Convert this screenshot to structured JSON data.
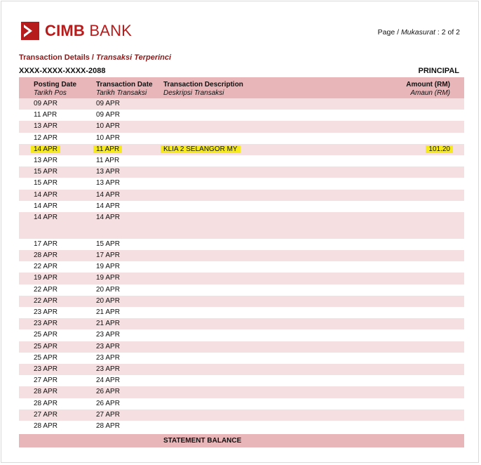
{
  "header": {
    "logo_bold": "CIMB",
    "logo_light": " BANK",
    "page_label_en": "Page / ",
    "page_label_ms": "Mukasurat",
    "page_value": " : 2 of  2"
  },
  "section": {
    "title_en": "Transaction Details / ",
    "title_ms": "Transaksi Terperinci",
    "card_number": "XXXX-XXXX-XXXX-2088",
    "principal": "PRINCIPAL"
  },
  "table": {
    "headers": {
      "posting_en": "Posting Date",
      "posting_ms": "Tarikh Pos",
      "trans_en": "Transaction Date",
      "trans_ms": "Tarikh Transaksi",
      "desc_en": "Transaction Description",
      "desc_ms": "Deskripsi Transaksi",
      "amount_en": "Amount (RM)",
      "amount_ms": "Amaun (RM)"
    },
    "rows": [
      {
        "post": "09 APR",
        "trans": "09 APR",
        "desc": "",
        "amount": ""
      },
      {
        "post": "11 APR",
        "trans": "09 APR",
        "desc": "",
        "amount": ""
      },
      {
        "post": "13 APR",
        "trans": "10 APR",
        "desc": "",
        "amount": ""
      },
      {
        "post": "12 APR",
        "trans": "10 APR",
        "desc": "",
        "amount": ""
      },
      {
        "post": "14 APR",
        "trans": "11 APR",
        "desc": "KLIA 2 SELANGOR MY",
        "amount": "101.20",
        "highlight": true
      },
      {
        "post": "13 APR",
        "trans": "11 APR",
        "desc": "",
        "amount": ""
      },
      {
        "post": "15 APR",
        "trans": "13 APR",
        "desc": "",
        "amount": ""
      },
      {
        "post": "15 APR",
        "trans": "13 APR",
        "desc": "",
        "amount": ""
      },
      {
        "post": "14 APR",
        "trans": "14 APR",
        "desc": "",
        "amount": ""
      },
      {
        "post": "14 APR",
        "trans": "14 APR",
        "desc": "",
        "amount": ""
      },
      {
        "post": "14 APR",
        "trans": "14 APR",
        "desc": "",
        "amount": "",
        "tall": true
      },
      {
        "post": "17 APR",
        "trans": "15 APR",
        "desc": "",
        "amount": ""
      },
      {
        "post": "28 APR",
        "trans": "17 APR",
        "desc": "",
        "amount": ""
      },
      {
        "post": "22 APR",
        "trans": "19 APR",
        "desc": "",
        "amount": ""
      },
      {
        "post": "19 APR",
        "trans": "19 APR",
        "desc": "",
        "amount": ""
      },
      {
        "post": "22 APR",
        "trans": "20 APR",
        "desc": "",
        "amount": ""
      },
      {
        "post": "22 APR",
        "trans": "20 APR",
        "desc": "",
        "amount": ""
      },
      {
        "post": "23 APR",
        "trans": "21 APR",
        "desc": "",
        "amount": ""
      },
      {
        "post": "23 APR",
        "trans": "21 APR",
        "desc": "",
        "amount": ""
      },
      {
        "post": "25 APR",
        "trans": "23 APR",
        "desc": "",
        "amount": ""
      },
      {
        "post": "25 APR",
        "trans": "23 APR",
        "desc": "",
        "amount": ""
      },
      {
        "post": "25 APR",
        "trans": "23 APR",
        "desc": "",
        "amount": ""
      },
      {
        "post": "23 APR",
        "trans": "23 APR",
        "desc": "",
        "amount": ""
      },
      {
        "post": "27 APR",
        "trans": "24 APR",
        "desc": "",
        "amount": ""
      },
      {
        "post": "28 APR",
        "trans": "26 APR",
        "desc": "",
        "amount": ""
      },
      {
        "post": "28 APR",
        "trans": "26 APR",
        "desc": "",
        "amount": ""
      },
      {
        "post": "27 APR",
        "trans": "27 APR",
        "desc": "",
        "amount": ""
      },
      {
        "post": "28 APR",
        "trans": "28 APR",
        "desc": "",
        "amount": ""
      }
    ],
    "statement_balance_label": "STATEMENT BALANCE"
  },
  "colors": {
    "brand_red": "#b71c1c",
    "title_red": "#8b1a1a",
    "header_pink": "#e8b5b8",
    "row_shade": "#f5dfe0",
    "highlight_yellow": "#f7ea1c"
  }
}
